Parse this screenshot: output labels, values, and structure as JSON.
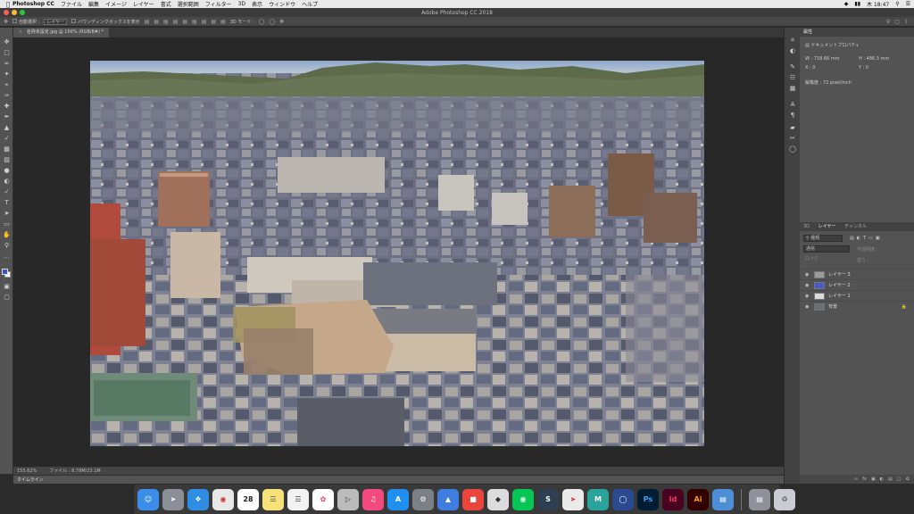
{
  "menubar": {
    "app_name": "Photoshop CC",
    "items": [
      "ファイル",
      "編集",
      "イメージ",
      "レイヤー",
      "書式",
      "選択範囲",
      "フィルター",
      "3D",
      "表示",
      "ウィンドウ",
      "ヘルプ"
    ],
    "clock": "木 18:47"
  },
  "window": {
    "title": "Adobe Photoshop CC 2018"
  },
  "options_bar": {
    "auto_select_label": "自動選択 :",
    "layer_select_value": "レイヤー",
    "bbox_label": "バウンディングボックスを表示",
    "mode_3d_label": "3D モード :"
  },
  "document_tab": {
    "label": "名称未設定.jpg @ 156% (RGB/8#) *"
  },
  "status_bar": {
    "zoom": "155.62%",
    "file_info": "ファイル : 8.78M/23.1M"
  },
  "timeline": {
    "label": "タイムライン"
  },
  "properties_panel": {
    "title": "属性",
    "section": "ドキュメントプロパティ",
    "w_label": "W :",
    "w_value": "718.66 mm",
    "h_label": "H :",
    "h_value": "486.3 mm",
    "x_label": "X :",
    "x_value": "0",
    "y_label": "Y :",
    "y_value": "0",
    "resolution": "解像度 : 72 pixel/inch"
  },
  "layers_panel": {
    "tabs": [
      "3D",
      "レイヤー",
      "チャンネル"
    ],
    "active_tab": "レイヤー",
    "filter_value": "種類",
    "blend_mode": "通常",
    "opacity_label": "不透明度 :",
    "lock_label": "ロック :",
    "fill_label": "塗り :",
    "layers": [
      {
        "name": "レイヤー 3",
        "thumb_color": "#9a9a9a"
      },
      {
        "name": "レイヤー 2",
        "thumb_color": "#4a58d0"
      },
      {
        "name": "レイヤー 1",
        "thumb_color": "#dcdcdc"
      },
      {
        "name": "背景",
        "thumb_color": "#6b6e70",
        "locked": true
      }
    ]
  },
  "dock": {
    "calendar_day": "28",
    "apps": [
      "Finder",
      "Launchpad",
      "Safari",
      "Chrome",
      "Calendar",
      "Notes",
      "Reminders",
      "Photos",
      "Keynote",
      "Music",
      "App Store",
      "System Preferences",
      "Affinity",
      "SketchUp",
      "Rhino",
      "LINE",
      "Sketchbook",
      "Maps",
      "Muse",
      "Cinema 4D",
      "Ps",
      "Id",
      "Ai",
      "Preview",
      "Downloads",
      "Trash"
    ],
    "labels": {
      "ps": "Ps",
      "id": "Id",
      "ai": "Ai",
      "m": "M",
      "s": "S"
    }
  }
}
